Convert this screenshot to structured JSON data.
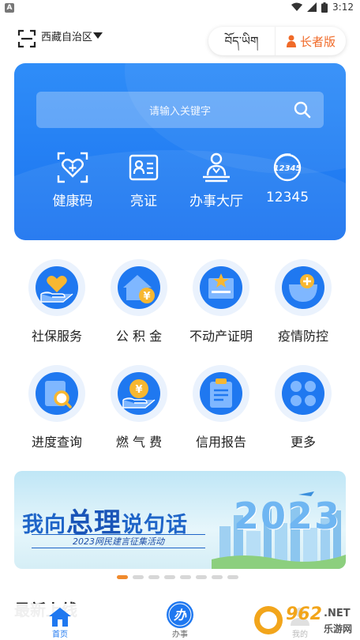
{
  "status_bar": {
    "time": "3:12",
    "notification_badge": "A"
  },
  "header": {
    "region": "西藏自治区",
    "tibetan_label": "བོད་ཡིག",
    "elder_label": "长者版"
  },
  "hero": {
    "search_placeholder": "请输入关键字",
    "quick_items": [
      {
        "label": "健康码",
        "icon": "health-code-icon"
      },
      {
        "label": "亮证",
        "icon": "id-card-icon"
      },
      {
        "label": "办事大厅",
        "icon": "service-hall-icon"
      },
      {
        "label": "12345",
        "icon": "hotline-12345-icon"
      }
    ]
  },
  "services": [
    {
      "label": "社保服务",
      "icon": "social-security-icon"
    },
    {
      "label": "公 积 金",
      "icon": "housing-fund-icon"
    },
    {
      "label": "不动产证明",
      "icon": "real-estate-icon"
    },
    {
      "label": "疫情防控",
      "icon": "epidemic-control-icon"
    },
    {
      "label": "进度查询",
      "icon": "progress-query-icon"
    },
    {
      "label": "燃 气 费",
      "icon": "gas-fee-icon"
    },
    {
      "label": "信用报告",
      "icon": "credit-report-icon"
    },
    {
      "label": "更多",
      "icon": "more-icon"
    }
  ],
  "banner": {
    "title_a": "我向",
    "title_b": "总理",
    "title_c": "说句话",
    "subtitle": "2023网民建言征集活动",
    "year": "2023",
    "page_count": 8,
    "active_page": 1
  },
  "latest": {
    "title": "最新上线"
  },
  "bottom_nav": {
    "items": [
      {
        "label": "首页",
        "icon": "home-icon",
        "active": true
      },
      {
        "label": "办事",
        "icon": "ban-service-icon",
        "active": false
      },
      {
        "label": "我的",
        "icon": "profile-icon",
        "active": false
      }
    ]
  },
  "watermark": {
    "text_a": "962",
    "text_b": ".NET",
    "text_c": "乐游网"
  },
  "colors": {
    "primary": "#1f78f0",
    "accent": "#f06a28",
    "dot_active": "#f08a2d"
  }
}
